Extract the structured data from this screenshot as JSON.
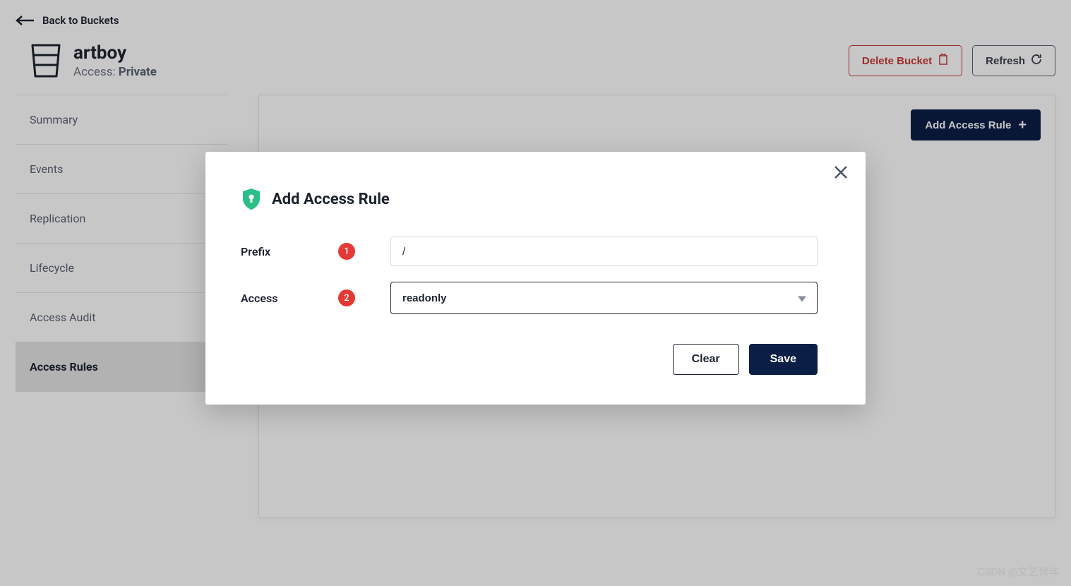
{
  "breadcrumb": {
    "label": "Back to Buckets"
  },
  "bucket": {
    "name": "artboy",
    "access_label": "Access:",
    "access_value": "Private"
  },
  "header_actions": {
    "delete_label": "Delete Bucket",
    "refresh_label": "Refresh"
  },
  "sidebar": {
    "items": [
      {
        "label": "Summary"
      },
      {
        "label": "Events"
      },
      {
        "label": "Replication"
      },
      {
        "label": "Lifecycle"
      },
      {
        "label": "Access Audit"
      },
      {
        "label": "Access Rules"
      }
    ],
    "active_index": 5
  },
  "panel": {
    "add_rule_label": "Add Access Rule"
  },
  "modal": {
    "title": "Add Access Rule",
    "prefix_label": "Prefix",
    "prefix_badge": "1",
    "prefix_value": "/",
    "access_label": "Access",
    "access_badge": "2",
    "access_value": "readonly",
    "clear_label": "Clear",
    "save_label": "Save"
  },
  "watermark": "CSDN @文艺倾年"
}
